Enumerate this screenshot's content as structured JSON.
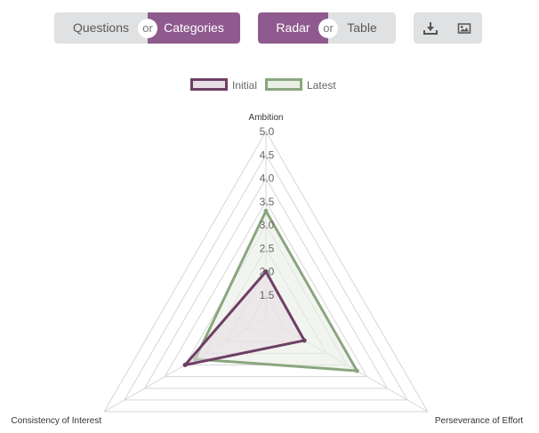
{
  "toolbar": {
    "view_toggle": {
      "left_label": "Questions",
      "or_label": "or",
      "right_label": "Categories",
      "active": "Categories"
    },
    "chart_toggle": {
      "left_label": "Radar",
      "or_label": "or",
      "right_label": "Table",
      "active": "Radar"
    },
    "icons": [
      "download-icon",
      "image-icon"
    ]
  },
  "colors": {
    "accent": "#8f5a8e",
    "initial_stroke": "#6e3f65",
    "initial_fill": "#e7dde5",
    "latest_stroke": "#8aa67e",
    "latest_fill": "#e9efe4",
    "grid": "#d6d6d6"
  },
  "chart_data": {
    "type": "radar",
    "categories": [
      "Ambition",
      "Perseverance of Effort",
      "Consistency of Interest"
    ],
    "r_ticks": [
      "1.5",
      "2.0",
      "2.5",
      "3.0",
      "3.5",
      "4.0",
      "4.5",
      "5.0"
    ],
    "rlim": [
      1,
      5
    ],
    "legend_position": "top",
    "series": [
      {
        "name": "Initial",
        "values": [
          2.0,
          1.95,
          3.0
        ]
      },
      {
        "name": "Latest",
        "values": [
          3.3,
          3.25,
          2.75
        ]
      }
    ]
  }
}
